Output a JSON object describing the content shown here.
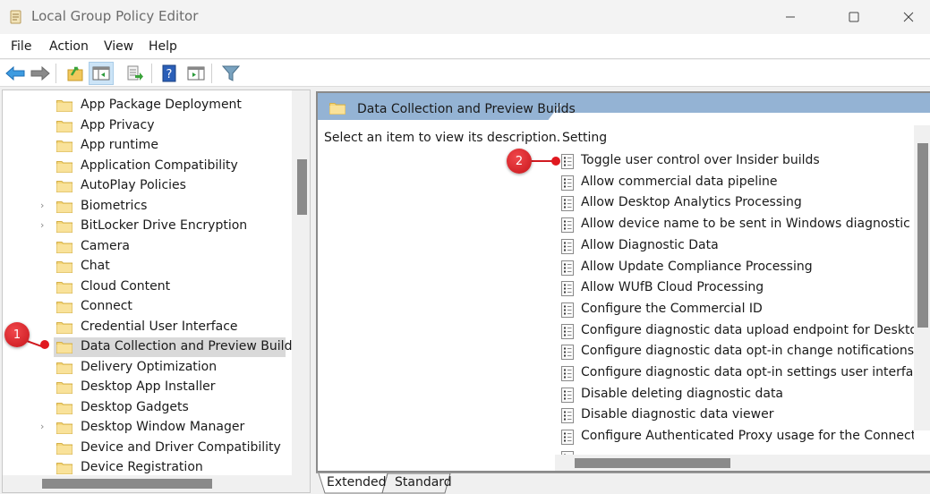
{
  "window": {
    "title": "Local Group Policy Editor",
    "controls": [
      "minimize",
      "maximize",
      "close"
    ]
  },
  "menubar": {
    "items": [
      {
        "label": "File"
      },
      {
        "label": "Action"
      },
      {
        "label": "View"
      },
      {
        "label": "Help"
      }
    ]
  },
  "toolbar": {
    "buttons": [
      {
        "name": "back",
        "icon": "arrow-left-icon"
      },
      {
        "name": "forward",
        "icon": "arrow-right-icon"
      },
      {
        "name": "up-one-level",
        "icon": "folder-up-icon"
      },
      {
        "name": "show-hide-console-tree",
        "icon": "console-tree-icon",
        "active": true
      },
      {
        "name": "export-list",
        "icon": "export-list-icon"
      },
      {
        "name": "help",
        "icon": "help-icon"
      },
      {
        "name": "show-hide-action-pane",
        "icon": "action-pane-icon"
      },
      {
        "name": "filter",
        "icon": "filter-icon"
      }
    ]
  },
  "tree": {
    "items": [
      {
        "label": "App Package Deployment",
        "expandable": false
      },
      {
        "label": "App Privacy",
        "expandable": false
      },
      {
        "label": "App runtime",
        "expandable": false
      },
      {
        "label": "Application Compatibility",
        "expandable": false
      },
      {
        "label": "AutoPlay Policies",
        "expandable": false
      },
      {
        "label": "Biometrics",
        "expandable": true
      },
      {
        "label": "BitLocker Drive Encryption",
        "expandable": true
      },
      {
        "label": "Camera",
        "expandable": false
      },
      {
        "label": "Chat",
        "expandable": false
      },
      {
        "label": "Cloud Content",
        "expandable": false
      },
      {
        "label": "Connect",
        "expandable": false
      },
      {
        "label": "Credential User Interface",
        "expandable": false
      },
      {
        "label": "Data Collection and Preview Builds",
        "expandable": false,
        "selected": true
      },
      {
        "label": "Delivery Optimization",
        "expandable": false
      },
      {
        "label": "Desktop App Installer",
        "expandable": false
      },
      {
        "label": "Desktop Gadgets",
        "expandable": false
      },
      {
        "label": "Desktop Window Manager",
        "expandable": true
      },
      {
        "label": "Device and Driver Compatibility",
        "expandable": false
      },
      {
        "label": "Device Registration",
        "expandable": false
      }
    ],
    "chevron_glyph": "›"
  },
  "details": {
    "header_title": "Data Collection and Preview Builds",
    "description": "Select an item to view its description.",
    "column_header": "Setting",
    "settings": [
      {
        "label": "Toggle user control over Insider builds"
      },
      {
        "label": "Allow commercial data pipeline"
      },
      {
        "label": "Allow Desktop Analytics Processing"
      },
      {
        "label": "Allow device name to be sent in Windows diagnostic data"
      },
      {
        "label": "Allow Diagnostic Data"
      },
      {
        "label": "Allow Update Compliance Processing"
      },
      {
        "label": "Allow WUfB Cloud Processing"
      },
      {
        "label": "Configure the Commercial ID"
      },
      {
        "label": "Configure diagnostic data upload endpoint for Desktop Analytics"
      },
      {
        "label": "Configure diagnostic data opt-in change notifications"
      },
      {
        "label": "Configure diagnostic data opt-in settings user interface"
      },
      {
        "label": "Disable deleting diagnostic data"
      },
      {
        "label": "Disable diagnostic data viewer"
      },
      {
        "label": "Configure Authenticated Proxy usage for the Connected User Experience and Telemetry service"
      },
      {
        "label": ""
      }
    ]
  },
  "bottom_tabs": [
    {
      "label": "Extended",
      "active": true
    },
    {
      "label": "Standard",
      "active": false
    }
  ],
  "annotations": [
    {
      "number": "1",
      "target": "tree item: Data Collection and Preview Builds"
    },
    {
      "number": "2",
      "target": "setting: Toggle user control over Insider builds"
    }
  ],
  "colors": {
    "header_band": "#94b3d4",
    "selection": "#d9d9d9",
    "badge": "#d11a20",
    "folder": "#f5d77a"
  }
}
